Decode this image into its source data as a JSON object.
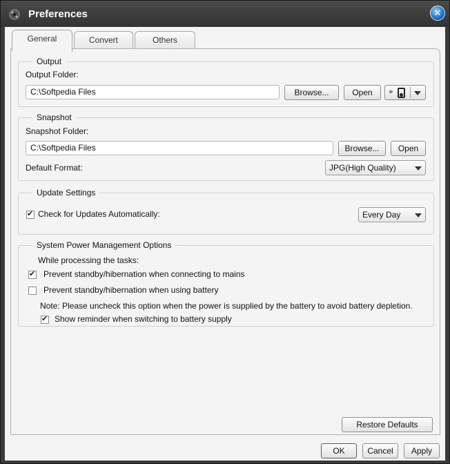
{
  "window": {
    "title": "Preferences"
  },
  "tabs": {
    "general": "General",
    "convert": "Convert",
    "others": "Others"
  },
  "output": {
    "legend": "Output",
    "folder_label": "Output Folder:",
    "folder_value": "C:\\Softpedia Files",
    "browse_label": "Browse...",
    "open_label": "Open"
  },
  "snapshot": {
    "legend": "Snapshot",
    "folder_label": "Snapshot Folder:",
    "folder_value": "C:\\Softpedia Files",
    "browse_label": "Browse...",
    "open_label": "Open",
    "format_label": "Default Format:",
    "format_value": "JPG(High Quality)"
  },
  "update": {
    "legend": "Update Settings",
    "check_label": "Check for Updates Automatically:",
    "check_checked": true,
    "frequency_value": "Every Day"
  },
  "power": {
    "legend": "System Power Management Options",
    "intro": "While processing the tasks:",
    "mains_label": "Prevent standby/hibernation when connecting to mains",
    "mains_checked": true,
    "battery_label": "Prevent standby/hibernation when using battery",
    "battery_checked": false,
    "note": "Note: Please uncheck this option when the power is supplied by the battery to avoid battery depletion.",
    "reminder_label": "Show reminder when switching to battery supply",
    "reminder_checked": true
  },
  "footer": {
    "restore_label": "Restore Defaults",
    "ok_label": "OK",
    "cancel_label": "Cancel",
    "apply_label": "Apply"
  }
}
